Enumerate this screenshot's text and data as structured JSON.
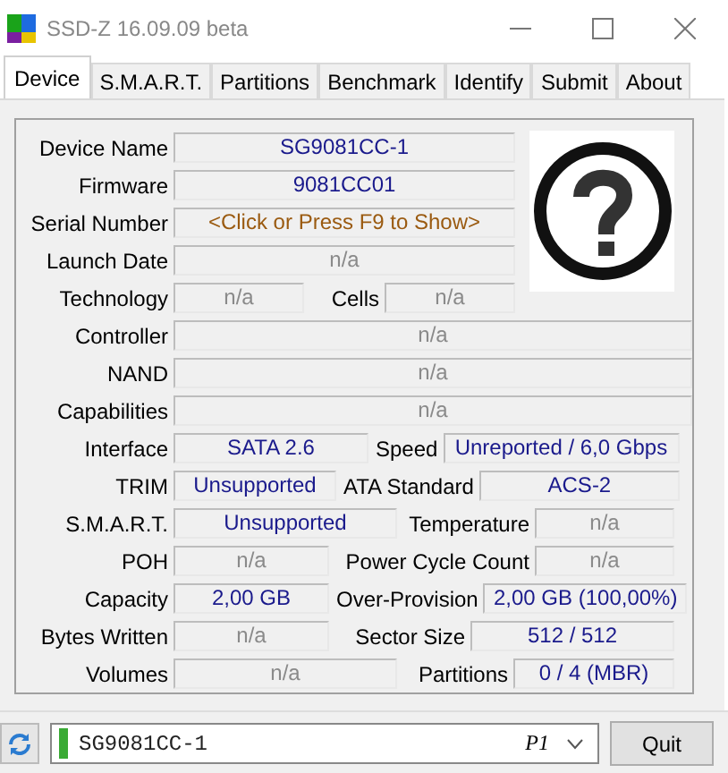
{
  "window": {
    "title": "SSD-Z 16.09.09 beta"
  },
  "tabs": [
    {
      "label": "Device",
      "selected": true
    },
    {
      "label": "S.M.A.R.T.",
      "selected": false
    },
    {
      "label": "Partitions",
      "selected": false
    },
    {
      "label": "Benchmark",
      "selected": false
    },
    {
      "label": "Identify",
      "selected": false
    },
    {
      "label": "Submit",
      "selected": false
    },
    {
      "label": "About",
      "selected": false
    }
  ],
  "device_rows": [
    {
      "fields": [
        {
          "label": "Device Name",
          "value": "SG9081CC-1",
          "kind": "value"
        }
      ]
    },
    {
      "fields": [
        {
          "label": "Firmware",
          "value": "9081CC01",
          "kind": "value"
        }
      ]
    },
    {
      "fields": [
        {
          "label": "Serial Number",
          "value": "<Click or Press F9 to Show>",
          "kind": "prompt"
        }
      ]
    },
    {
      "fields": [
        {
          "label": "Launch Date",
          "value": "n/a",
          "kind": "unavailable"
        }
      ]
    },
    {
      "fields": [
        {
          "label": "Technology",
          "value": "n/a",
          "kind": "unavailable"
        },
        {
          "label": "Cells",
          "value": "n/a",
          "kind": "unavailable"
        }
      ]
    },
    {
      "fields": [
        {
          "label": "Controller",
          "value": "n/a",
          "kind": "unavailable"
        }
      ]
    },
    {
      "fields": [
        {
          "label": "NAND",
          "value": "n/a",
          "kind": "unavailable"
        }
      ]
    },
    {
      "fields": [
        {
          "label": "Capabilities",
          "value": "n/a",
          "kind": "unavailable"
        }
      ]
    },
    {
      "fields": [
        {
          "label": "Interface",
          "value": "SATA 2.6",
          "kind": "value"
        },
        {
          "label": "Speed",
          "value": "Unreported / 6,0 Gbps",
          "kind": "value"
        }
      ]
    },
    {
      "fields": [
        {
          "label": "TRIM",
          "value": "Unsupported",
          "kind": "value"
        },
        {
          "label": "ATA Standard",
          "value": "ACS-2",
          "kind": "value"
        }
      ]
    },
    {
      "fields": [
        {
          "label": "S.M.A.R.T.",
          "value": "Unsupported",
          "kind": "value"
        },
        {
          "label": "Temperature",
          "value": "n/a",
          "kind": "unavailable"
        }
      ]
    },
    {
      "fields": [
        {
          "label": "POH",
          "value": "n/a",
          "kind": "unavailable"
        },
        {
          "label": "Power Cycle Count",
          "value": "n/a",
          "kind": "unavailable"
        }
      ]
    },
    {
      "fields": [
        {
          "label": "Capacity",
          "value": "2,00 GB",
          "kind": "value"
        },
        {
          "label": "Over-Provision",
          "value": "2,00 GB (100,00%)",
          "kind": "value"
        }
      ]
    },
    {
      "fields": [
        {
          "label": "Bytes Written",
          "value": "n/a",
          "kind": "unavailable"
        },
        {
          "label": "Sector Size",
          "value": "512 / 512",
          "kind": "value"
        }
      ]
    },
    {
      "fields": [
        {
          "label": "Volumes",
          "value": "n/a",
          "kind": "unavailable"
        },
        {
          "label": "Partitions",
          "value": "0 / 4 (MBR)",
          "kind": "value"
        }
      ]
    }
  ],
  "drive_selector": {
    "value": "SG9081CC-1",
    "partition": "P1"
  },
  "buttons": [
    "Quit"
  ]
}
